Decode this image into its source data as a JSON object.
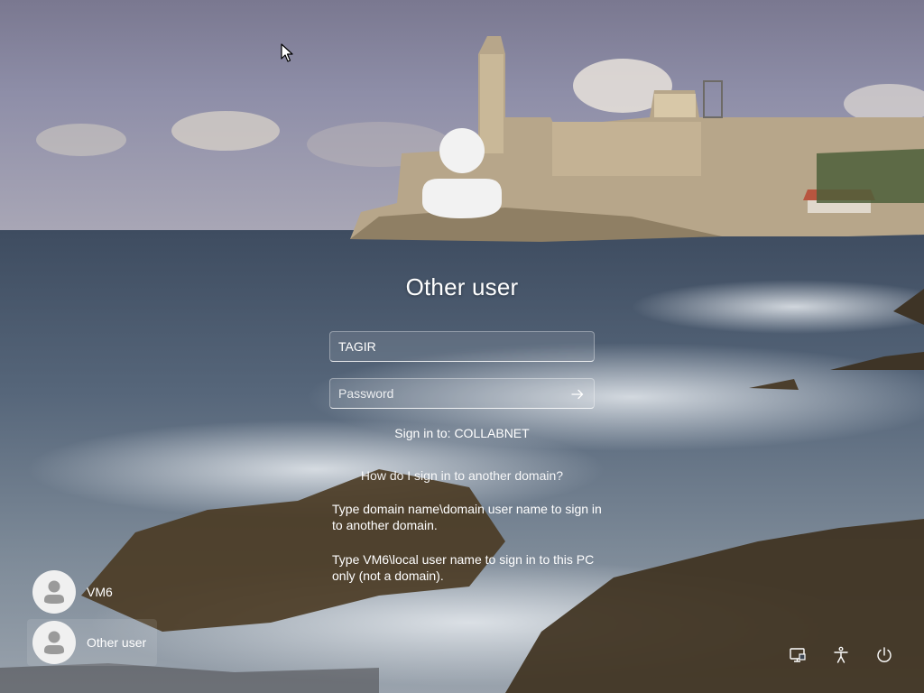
{
  "lock_screen": {
    "username_title": "Other user",
    "username_value": "TAGIR",
    "password_placeholder": "Password",
    "sign_in_to": "Sign in to: COLLABNET",
    "help_link": "How do I sign in to another domain?",
    "help_text_1": "Type domain name\\domain user name to sign in to another domain.",
    "help_text_2": "Type VM6\\local user name to sign in to this PC only (not a domain)."
  },
  "users": [
    {
      "label": "VM6",
      "icon": "user-avatar-icon",
      "selected": false
    },
    {
      "label": "Other user",
      "icon": "user-avatar-icon",
      "selected": true
    }
  ],
  "system_buttons": [
    {
      "icon": "network-icon"
    },
    {
      "icon": "accessibility-icon"
    },
    {
      "icon": "power-icon"
    }
  ],
  "colors": {
    "text": "#ffffff",
    "avatar_fill": "#f2f2f2",
    "tile_avatar_bg": "#f0f0f0",
    "tile_avatar_fg": "#9a9a9a"
  }
}
